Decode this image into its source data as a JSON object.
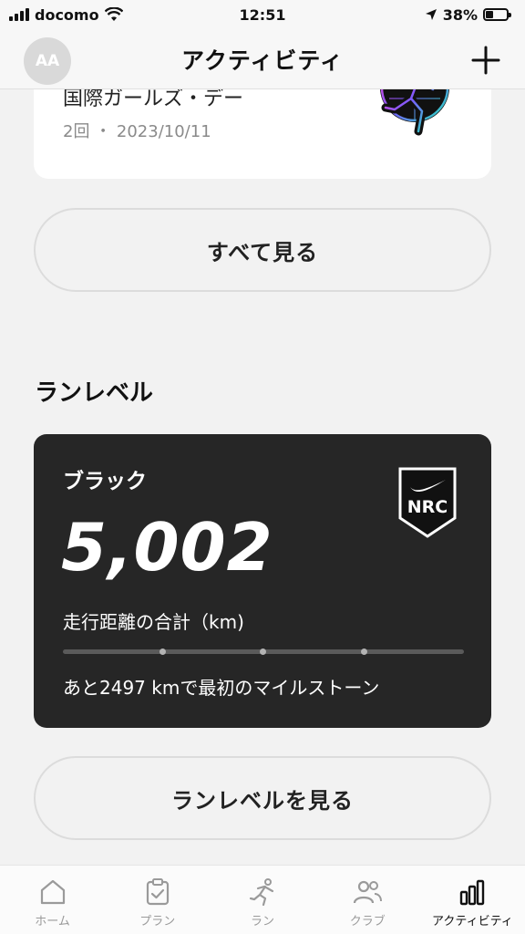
{
  "status_bar": {
    "carrier": "docomo",
    "time": "12:51",
    "battery": "38%",
    "battery_level": 0.38
  },
  "header": {
    "avatar_initials": "AA",
    "title": "アクティビティ"
  },
  "achievement": {
    "title": "国際ガールズ・デー",
    "meta": "2回 ・ 2023/10/11"
  },
  "see_all_label": "すべて見る",
  "run_level": {
    "section_title": "ランレベル",
    "level_name": "ブラック",
    "total_distance": "5,002",
    "distance_label": "走行距離の合計（km)",
    "milestone_text": "あと2497 kmで最初のマイルストーン",
    "badge_text": "NRC",
    "progress": 0.0
  },
  "see_runlevel_label": "ランレベルを見る",
  "tabs": [
    {
      "label": "ホーム",
      "icon": "home-icon",
      "active": false
    },
    {
      "label": "プラン",
      "icon": "clipboard-check-icon",
      "active": false
    },
    {
      "label": "ラン",
      "icon": "runner-icon",
      "active": false
    },
    {
      "label": "クラブ",
      "icon": "people-icon",
      "active": false
    },
    {
      "label": "アクティビティ",
      "icon": "bar-chart-icon",
      "active": true
    }
  ]
}
